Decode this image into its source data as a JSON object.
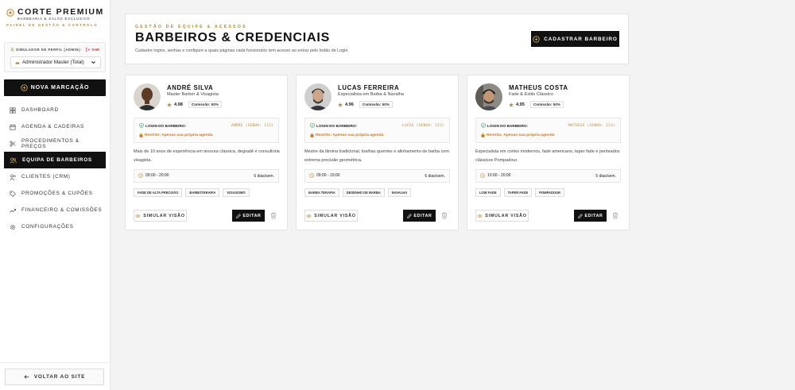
{
  "brand": {
    "name": "CORTE PREMIUM",
    "subtitle": "BARBEARIA & SALÃO EXCLUSIVO",
    "panel": "PAINEL DE GESTÃO & CONTROLO"
  },
  "profile": {
    "label": "SIMULADOR DE PERFIL (ADMIN):",
    "exit": "SAIR",
    "selected": "Administrador Master (Total)"
  },
  "sidebar": {
    "new_booking": "NOVA MARCAÇÃO",
    "items": [
      {
        "label": "DASHBOARD",
        "icon": "dashboard-grid-icon"
      },
      {
        "label": "AGENDA & CADEIRAS",
        "icon": "calendar-icon"
      },
      {
        "label": "PROCEDIMENTOS & PREÇOS",
        "icon": "scissors-icon"
      },
      {
        "label": "EQUIPA DE BARBEIROS",
        "icon": "team-icon",
        "active": true
      },
      {
        "label": "CLIENTES (CRM)",
        "icon": "user-plus-icon"
      },
      {
        "label": "PROMOÇÕES & CUPÕES",
        "icon": "tag-icon"
      },
      {
        "label": "FINANCEIRO & COMISSÕES",
        "icon": "trend-up-icon"
      },
      {
        "label": "CONFIGURAÇÕES",
        "icon": "gear-icon"
      }
    ],
    "back": "VOLTAR AO SITE"
  },
  "header": {
    "kicker": "GESTÃO DE EQUIPE & ACESSOS",
    "title": "BARBEIROS & CREDENCIAIS",
    "description": "Cadastre logins, senhas e configure a quais páginas cada funcionário tem acesso ao entrar pelo botão de Login.",
    "add_button": "CADASTRAR BARBEIRO"
  },
  "barbers": [
    {
      "name": "ANDRÉ SILVA",
      "specialty": "Master Barber & Visagista",
      "rating": "4.98",
      "commission": "Comissão: 50%",
      "login_label": "LOGIN DO BARBEIRO:",
      "credentials": "ANDRE (SENHA: 123)",
      "restriction": "Restrito: Apenas sua própria agenda",
      "bio": "Mais de 10 anos de experiência em tesoura clássica, degradê e consultoria visagista.",
      "hours": "09:00 - 20:00",
      "days": "6 dias/sem.",
      "tags": [
        "FADE DE ALTA PRECISÃO",
        "BARBOTERAPIA",
        "VISAGISMO"
      ],
      "simulate": "SIMULAR VISÃO",
      "edit": "EDITAR"
    },
    {
      "name": "LUCAS FERREIRA",
      "specialty": "Especialista em Barba & Navalha",
      "rating": "4.96",
      "commission": "Comissão: 50%",
      "login_label": "LOGIN DO BARBEIRO:",
      "credentials": "LUCAS (SENHA: 123)",
      "restriction": "Restrito: Apenas sua própria agenda",
      "bio": "Mestre da lâmina tradicional, toalhas quentes e alinhamento de barba com extrema precisão geométrica.",
      "hours": "09:00 - 19:00",
      "days": "6 dias/sem.",
      "tags": [
        "BARBA TERAPIA",
        "DESENHO DE BARBA",
        "NAVALHA"
      ],
      "simulate": "SIMULAR VISÃO",
      "edit": "EDITAR"
    },
    {
      "name": "MATHEUS COSTA",
      "specialty": "Fade & Estilo Clássico",
      "rating": "4.95",
      "commission": "Comissão: 50%",
      "login_label": "LOGIN DO BARBEIRO:",
      "credentials": "MATHEUS (SENHA: 123)",
      "restriction": "Restrito: Apenas sua própria agenda",
      "bio": "Especialista em cortes modernos, fade americano, taper fade e penteados clássicos Pompadour.",
      "hours": "10:00 - 20:00",
      "days": "5 dias/sem.",
      "tags": [
        "LOW FADE",
        "TAPER FADE",
        "POMPADOUR"
      ],
      "simulate": "SIMULAR VISÃO",
      "edit": "EDITAR"
    }
  ],
  "colors": {
    "accent_gold": "#b58b3d",
    "dark": "#111111",
    "restriction_orange": "#c27a2a",
    "login_check_green": "#3a9a5b",
    "exit_red": "#c23b3b"
  }
}
